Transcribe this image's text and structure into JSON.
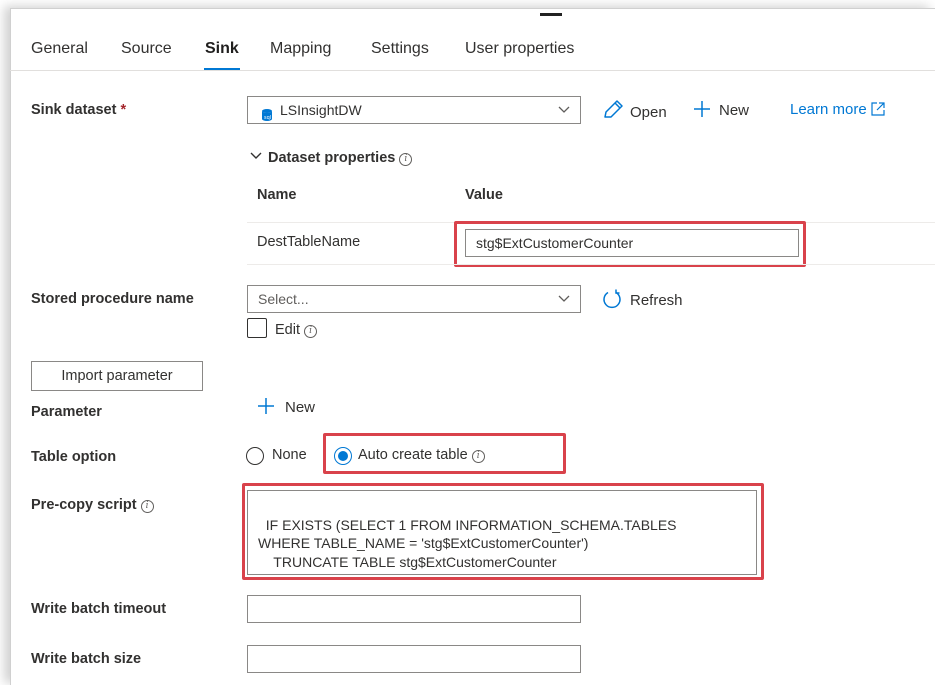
{
  "tabs": [
    {
      "label": "General"
    },
    {
      "label": "Source"
    },
    {
      "label": "Sink"
    },
    {
      "label": "Mapping"
    },
    {
      "label": "Settings"
    },
    {
      "label": "User properties"
    }
  ],
  "active_tab": "Sink",
  "sink_dataset": {
    "label": "Sink dataset",
    "required_mark": "*",
    "value": "LSInsightDW",
    "open_label": "Open",
    "new_label": "New",
    "learn_more_label": "Learn more"
  },
  "dataset_properties": {
    "title": "Dataset properties",
    "col_name": "Name",
    "col_value": "Value",
    "rows": [
      {
        "name": "DestTableName",
        "value": "stg$ExtCustomerCounter"
      }
    ]
  },
  "stored_procedure": {
    "label": "Stored procedure name",
    "placeholder": "Select...",
    "refresh_label": "Refresh",
    "edit_label": "Edit"
  },
  "import_parameter_label": "Import parameter",
  "parameter": {
    "label": "Parameter",
    "new_label": "New"
  },
  "table_option": {
    "label": "Table option",
    "options": [
      "None",
      "Auto create table"
    ],
    "selected": "Auto create table"
  },
  "pre_copy_script": {
    "label": "Pre-copy script",
    "value": "IF EXISTS (SELECT 1 FROM INFORMATION_SCHEMA.TABLES\nWHERE TABLE_NAME = 'stg$ExtCustomerCounter')\n    TRUNCATE TABLE stg$ExtCustomerCounter"
  },
  "write_batch_timeout": {
    "label": "Write batch timeout",
    "value": ""
  },
  "write_batch_size": {
    "label": "Write batch size",
    "value": ""
  },
  "colors": {
    "accent": "#0078d4",
    "highlight": "#d9424b",
    "required": "#a4262c"
  }
}
